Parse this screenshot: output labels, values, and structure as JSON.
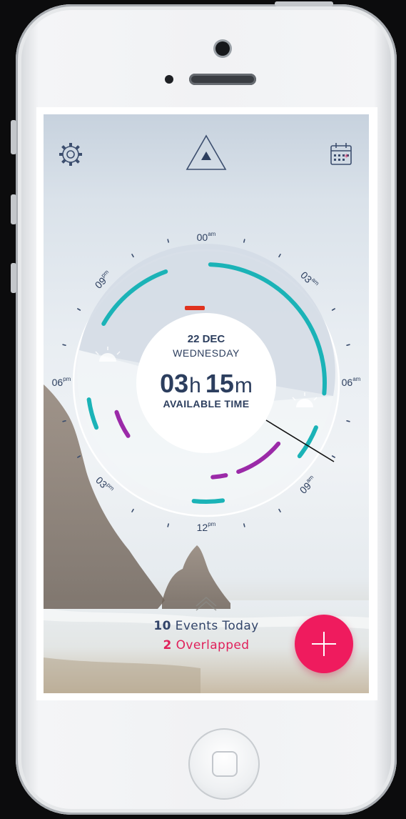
{
  "header": {
    "settings_icon": "gear-icon",
    "logo_icon": "triangle-logo-icon",
    "calendar_icon": "calendar-icon"
  },
  "dial": {
    "hour_labels": [
      {
        "num": "00",
        "suffix": "am"
      },
      {
        "num": "03",
        "suffix": "am"
      },
      {
        "num": "06",
        "suffix": "am"
      },
      {
        "num": "09",
        "suffix": "am"
      },
      {
        "num": "12",
        "suffix": "pm"
      },
      {
        "num": "03",
        "suffix": "pm"
      },
      {
        "num": "06",
        "suffix": "pm"
      },
      {
        "num": "09",
        "suffix": "pm"
      }
    ],
    "date": "22 DEC",
    "weekday": "WEDNESDAY",
    "hours_value": "03",
    "hours_unit": "h",
    "minutes_value": "15",
    "minutes_unit": "m",
    "caption": "AVAILABLE TIME"
  },
  "footer": {
    "events_count": "10",
    "events_label": "Events Today",
    "overlap_count": "2",
    "overlap_label": "Overlapped",
    "add_icon": "plus-icon"
  },
  "colors": {
    "accent": "#ef1b5e",
    "teal": "#1bb3b7",
    "purple": "#9b2aa8",
    "red": "#e0321e",
    "navy": "#2c3e5e"
  }
}
